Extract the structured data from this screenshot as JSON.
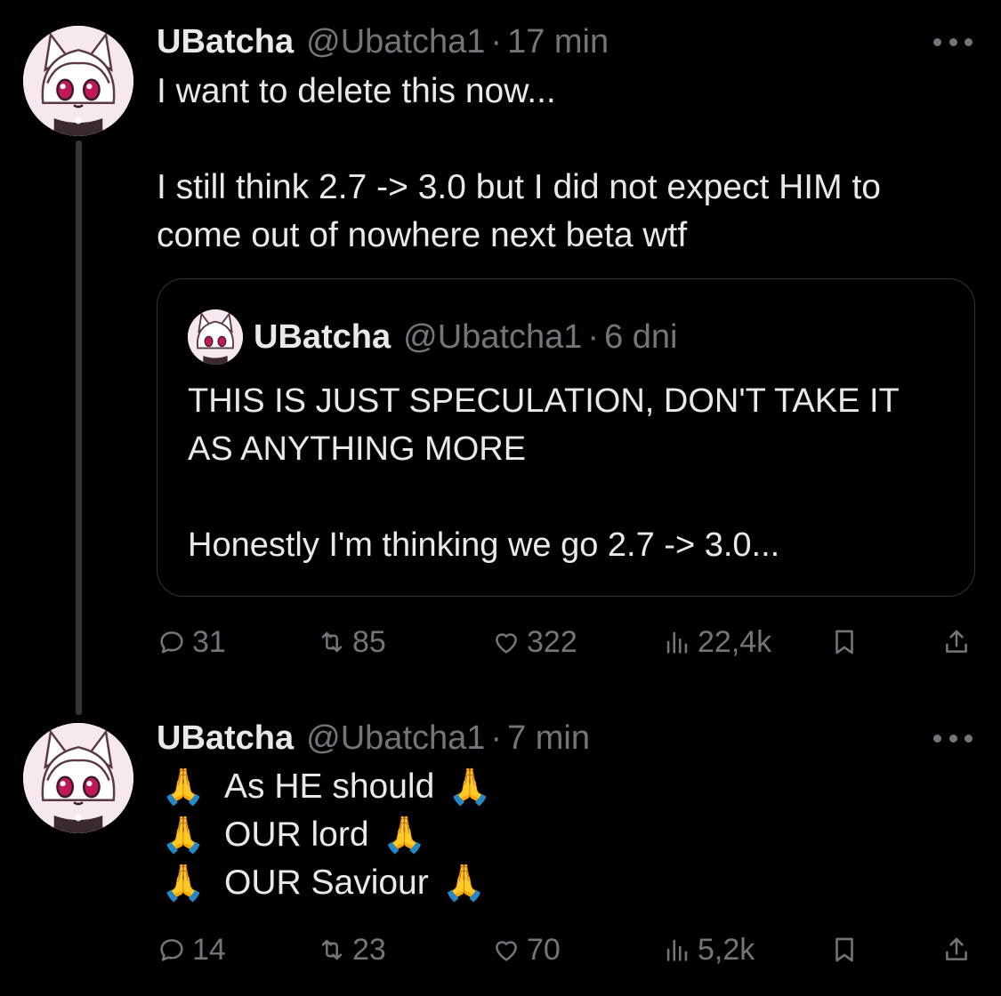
{
  "tweets": [
    {
      "author": {
        "name": "UBatcha",
        "handle": "@Ubatcha1"
      },
      "separator": "·",
      "time": "17 min",
      "text_lines": [
        "I want to delete this now...",
        "",
        "I still think 2.7 -> 3.0 but I did not expect HIM to come out of nowhere next beta wtf"
      ],
      "quote": {
        "author": {
          "name": "UBatcha",
          "handle": "@Ubatcha1"
        },
        "separator": "·",
        "time": "6 dni",
        "text_lines": [
          "THIS IS JUST SPECULATION, DON'T TAKE IT AS ANYTHING MORE",
          "",
          "Honestly I'm thinking we go 2.7 -> 3.0..."
        ]
      },
      "stats": {
        "replies": "31",
        "retweets": "85",
        "likes": "322",
        "views": "22,4k"
      }
    },
    {
      "author": {
        "name": "UBatcha",
        "handle": "@Ubatcha1"
      },
      "separator": "·",
      "time": "7 min",
      "prayer_emoji": "🙏",
      "lines": [
        "As HE should",
        "OUR lord",
        "OUR Saviour"
      ],
      "stats": {
        "replies": "14",
        "retweets": "23",
        "likes": "70",
        "views": "5,2k"
      }
    }
  ],
  "icons": {
    "more": "more-icon",
    "reply": "reply-icon",
    "retweet": "retweet-icon",
    "like": "heart-icon",
    "views": "views-icon",
    "bookmark": "bookmark-icon",
    "share": "share-icon"
  },
  "colors": {
    "background": "#000000",
    "text": "#e7e9ea",
    "muted": "#71767b",
    "border": "#2f3336"
  }
}
